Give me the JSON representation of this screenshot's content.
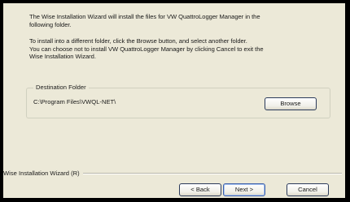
{
  "wizard": {
    "intro_text": "The Wise Installation Wizard will install the files for VW QuattroLogger Manager in the\nfollowing folder.",
    "instructions_text": "To install into a different folder, click the Browse button, and select another folder.\nYou can choose not to install VW QuattroLogger Manager by clicking Cancel to exit the\nWise Installation Wizard.",
    "destination": {
      "legend": "Destination Folder",
      "path": "C:\\Program Files\\VWQL-NET\\",
      "browse_label": "Browse"
    },
    "footer": {
      "brand": "Wise Installation Wizard (R)",
      "back_label": "< Back",
      "next_label": "Next >",
      "cancel_label": "Cancel"
    }
  },
  "colors": {
    "dialog_background": "#ece9d8",
    "border": "#000000"
  }
}
